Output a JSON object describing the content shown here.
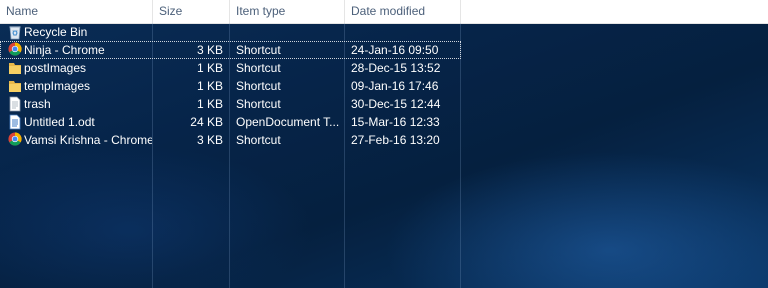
{
  "columns": {
    "name": "Name",
    "size": "Size",
    "type": "Item type",
    "date": "Date modified"
  },
  "rows": [
    {
      "name": "Recycle Bin",
      "size": "",
      "type": "",
      "date": "",
      "icon": "recycle-bin-icon"
    },
    {
      "name": "Ninja - Chrome",
      "size": "3 KB",
      "type": "Shortcut",
      "date": "24-Jan-16 09:50",
      "icon": "chrome-icon",
      "focused": true
    },
    {
      "name": "postImages",
      "size": "1 KB",
      "type": "Shortcut",
      "date": "28-Dec-15 13:52",
      "icon": "folder-icon"
    },
    {
      "name": "tempImages",
      "size": "1 KB",
      "type": "Shortcut",
      "date": "09-Jan-16 17:46",
      "icon": "folder-icon"
    },
    {
      "name": "trash",
      "size": "1 KB",
      "type": "Shortcut",
      "date": "30-Dec-15 12:44",
      "icon": "text-file-icon"
    },
    {
      "name": "Untitled 1.odt",
      "size": "24 KB",
      "type": "OpenDocument T...",
      "date": "15-Mar-16 12:33",
      "icon": "document-icon"
    },
    {
      "name": "Vamsi Krishna - Chrome",
      "size": "3 KB",
      "type": "Shortcut",
      "date": "27-Feb-16 13:20",
      "icon": "chrome-icon"
    }
  ],
  "colors": {
    "header_bg": "#ffffff",
    "header_text": "#4c607a",
    "desktop_bg": "#062449",
    "row_text": "#ffffff"
  }
}
